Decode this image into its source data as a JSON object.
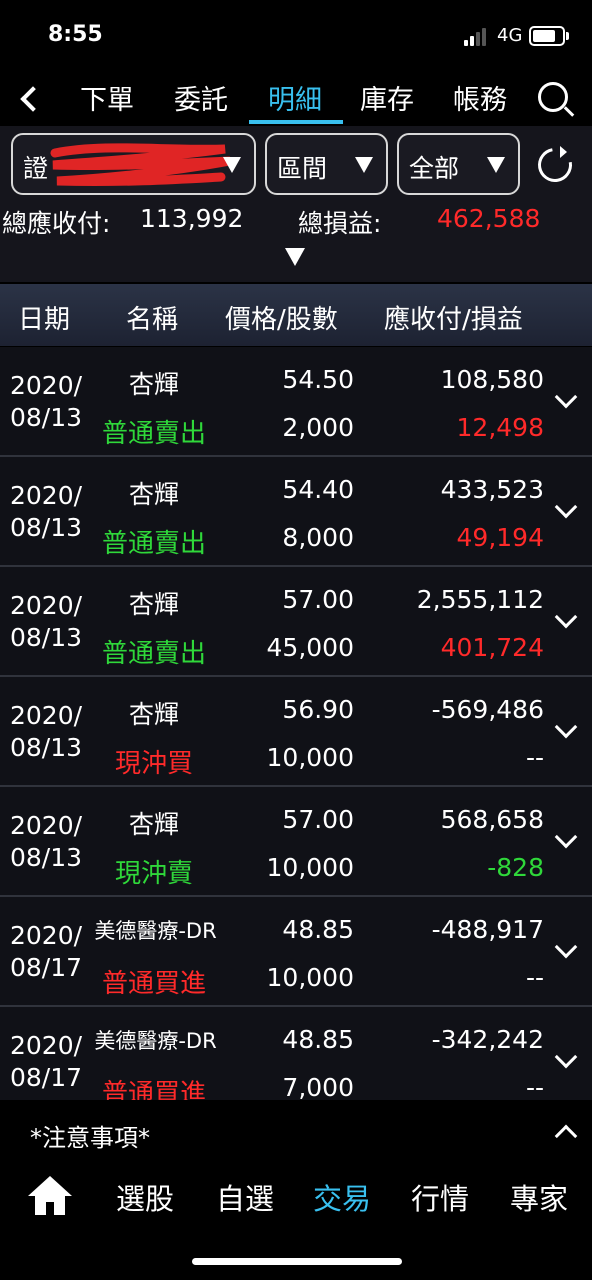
{
  "status": {
    "time": "8:55",
    "network": "4G"
  },
  "nav": {
    "tabs": [
      "下單",
      "委託",
      "明細",
      "庫存",
      "帳務"
    ],
    "active_tab": "明細"
  },
  "filters": {
    "account_visible_prefix": "證",
    "range_label": "區間",
    "scope_label": "全部"
  },
  "summary": {
    "receivable_label": "總應收付:",
    "receivable_value": "113,992",
    "pnl_label": "總損益:",
    "pnl_value": "462,588"
  },
  "table": {
    "headers": [
      "日期",
      "名稱",
      "價格/股數",
      "應收付/損益"
    ],
    "rows": [
      {
        "date_year": "2020/",
        "date_md": "08/13",
        "name": "杏輝",
        "type": "普通賣出",
        "price": "54.50",
        "shares": "2,000",
        "amount": "108,580",
        "pnl": "12,498"
      },
      {
        "date_year": "2020/",
        "date_md": "08/13",
        "name": "杏輝",
        "type": "普通賣出",
        "price": "54.40",
        "shares": "8,000",
        "amount": "433,523",
        "pnl": "49,194"
      },
      {
        "date_year": "2020/",
        "date_md": "08/13",
        "name": "杏輝",
        "type": "普通賣出",
        "price": "57.00",
        "shares": "45,000",
        "amount": "2,555,112",
        "pnl": "401,724"
      },
      {
        "date_year": "2020/",
        "date_md": "08/13",
        "name": "杏輝",
        "type": "現沖買",
        "price": "56.90",
        "shares": "10,000",
        "amount": "-569,486",
        "pnl": "--"
      },
      {
        "date_year": "2020/",
        "date_md": "08/13",
        "name": "杏輝",
        "type": "現沖賣",
        "price": "57.00",
        "shares": "10,000",
        "amount": "568,658",
        "pnl": "-828"
      },
      {
        "date_year": "2020/",
        "date_md": "08/17",
        "name": "美德醫療-DR",
        "type": "普通買進",
        "price": "48.85",
        "shares": "10,000",
        "amount": "-488,917",
        "pnl": "--"
      },
      {
        "date_year": "2020/",
        "date_md": "08/17",
        "name": "美德醫療-DR",
        "type": "普通買進",
        "price": "48.85",
        "shares": "7,000",
        "amount": "-342,242",
        "pnl": "--"
      }
    ]
  },
  "notice": {
    "label": "*注意事項*"
  },
  "bottom_nav": {
    "items": [
      "選股",
      "自選",
      "交易",
      "行情",
      "專家"
    ],
    "active": "交易"
  },
  "colors": {
    "accent": "#39c0ef",
    "profit": "#ff2a2a",
    "loss": "#2fd83a",
    "sell": "#2fd83a",
    "buy": "#ff2a2a"
  },
  "icons": [
    "back-icon",
    "search-icon",
    "refresh-icon",
    "chevron-down-icon",
    "chevron-up-icon",
    "home-icon"
  ]
}
